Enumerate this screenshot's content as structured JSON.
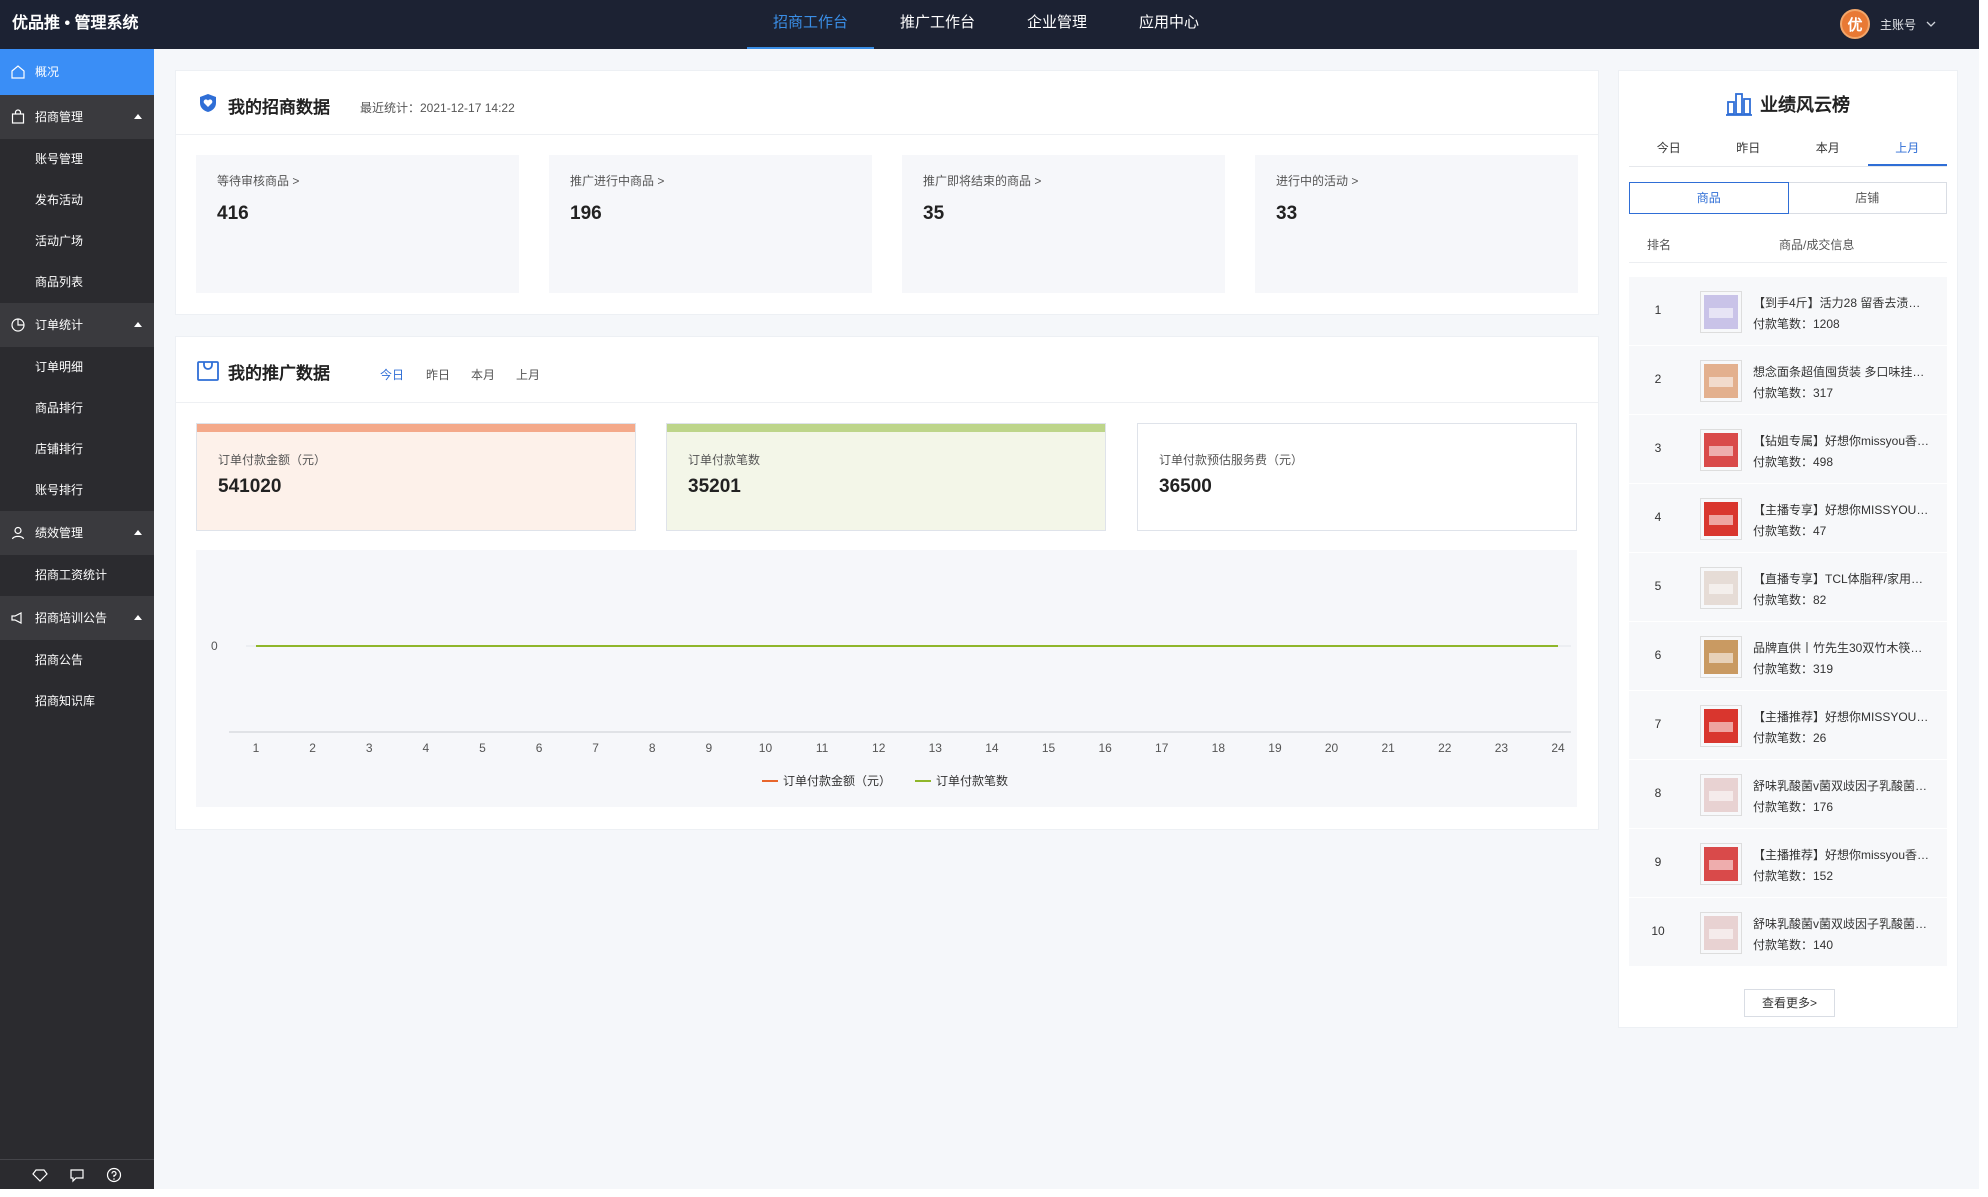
{
  "app": {
    "title": "优品推 • 管理系统"
  },
  "topnav": [
    {
      "label": "招商工作台",
      "active": true
    },
    {
      "label": "推广工作台",
      "active": false
    },
    {
      "label": "企业管理",
      "active": false
    },
    {
      "label": "应用中心",
      "active": false
    }
  ],
  "account": {
    "avatar_char": "优",
    "name": "主账号"
  },
  "sidebar": {
    "home": "概况",
    "groups": [
      {
        "label": "招商管理",
        "items": [
          "账号管理",
          "发布活动",
          "活动广场",
          "商品列表"
        ]
      },
      {
        "label": "订单统计",
        "items": [
          "订单明细",
          "商品排行",
          "店铺排行",
          "账号排行"
        ]
      },
      {
        "label": "绩效管理",
        "items": [
          "招商工资统计"
        ]
      },
      {
        "label": "招商培训公告",
        "items": [
          "招商公告",
          "招商知识库"
        ]
      }
    ]
  },
  "merchant": {
    "title": "我的招商数据",
    "updated": "最近统计：2021-12-17 14:22",
    "stats": [
      {
        "label": "等待审核商品 >",
        "value": "416"
      },
      {
        "label": "推广进行中商品 >",
        "value": "196"
      },
      {
        "label": "推广即将结束的商品 >",
        "value": "35"
      },
      {
        "label": "进行中的活动 >",
        "value": "33"
      }
    ]
  },
  "promo": {
    "title": "我的推广数据",
    "tabs": [
      "今日",
      "昨日",
      "本月",
      "上月"
    ],
    "active_tab": 0,
    "metrics": [
      {
        "label": "订单付款金额（元）",
        "value": "541020",
        "bar": "#f4a98a",
        "bg": "#fdf1ea"
      },
      {
        "label": "订单付款笔数",
        "value": "35201",
        "bar": "#bdd58a",
        "bg": "#f3f6e8"
      },
      {
        "label": "订单付款预估服务费（元）",
        "value": "36500",
        "bar": "",
        "bg": "#ffffff"
      }
    ]
  },
  "chart_data": {
    "type": "line",
    "x": [
      "1",
      "2",
      "3",
      "4",
      "5",
      "6",
      "7",
      "8",
      "9",
      "10",
      "11",
      "12",
      "13",
      "14",
      "15",
      "16",
      "17",
      "18",
      "19",
      "20",
      "21",
      "22",
      "23",
      "24"
    ],
    "y_ticks": [
      "0"
    ],
    "series": [
      {
        "name": "订单付款金额（元）",
        "color": "#e8662c",
        "values": [
          0,
          0,
          0,
          0,
          0,
          0,
          0,
          0,
          0,
          0,
          0,
          0,
          0,
          0,
          0,
          0,
          0,
          0,
          0,
          0,
          0,
          0,
          0,
          0
        ]
      },
      {
        "name": "订单付款笔数",
        "color": "#8fb62a",
        "values": [
          0,
          0,
          0,
          0,
          0,
          0,
          0,
          0,
          0,
          0,
          0,
          0,
          0,
          0,
          0,
          0,
          0,
          0,
          0,
          0,
          0,
          0,
          0,
          0
        ]
      }
    ],
    "legend_position": "bottom"
  },
  "ranking": {
    "title": "业绩风云榜",
    "tabs": [
      "今日",
      "昨日",
      "本月",
      "上月"
    ],
    "active_tab": 3,
    "segments": [
      "商品",
      "店铺"
    ],
    "active_segment": 0,
    "col_rank": "排名",
    "col_info": "商品/成交信息",
    "rows": [
      {
        "rank": "1",
        "name": "【到手4斤】活力28 留香去渍…",
        "count": "付款笔数：1208",
        "thumb": "#c9c3e8"
      },
      {
        "rank": "2",
        "name": "想念面条超值囤货装 多口味挂…",
        "count": "付款笔数：317",
        "thumb": "#e3b08e"
      },
      {
        "rank": "3",
        "name": "【钻姐专属】好想你missyou香…",
        "count": "付款笔数：498",
        "thumb": "#d94a4a"
      },
      {
        "rank": "4",
        "name": "【主播专享】好想你MISSYOU…",
        "count": "付款笔数：47",
        "thumb": "#d9362e"
      },
      {
        "rank": "5",
        "name": "【直播专享】TCL体脂秤/家用…",
        "count": "付款笔数：82",
        "thumb": "#e6dcd6"
      },
      {
        "rank": "6",
        "name": "品牌直供丨竹先生30双竹木筷…",
        "count": "付款笔数：319",
        "thumb": "#c99a62"
      },
      {
        "rank": "7",
        "name": "【主播推荐】好想你MISSYOU…",
        "count": "付款笔数：26",
        "thumb": "#d9362e"
      },
      {
        "rank": "8",
        "name": "舒味乳酸菌v菌双歧因子乳酸菌…",
        "count": "付款笔数：176",
        "thumb": "#e8d2d2"
      },
      {
        "rank": "9",
        "name": "【主播推荐】好想你missyou香…",
        "count": "付款笔数：152",
        "thumb": "#d94a4a"
      },
      {
        "rank": "10",
        "name": "舒味乳酸菌v菌双歧因子乳酸菌…",
        "count": "付款笔数：140",
        "thumb": "#e8d2d2"
      }
    ],
    "more": "查看更多>"
  }
}
